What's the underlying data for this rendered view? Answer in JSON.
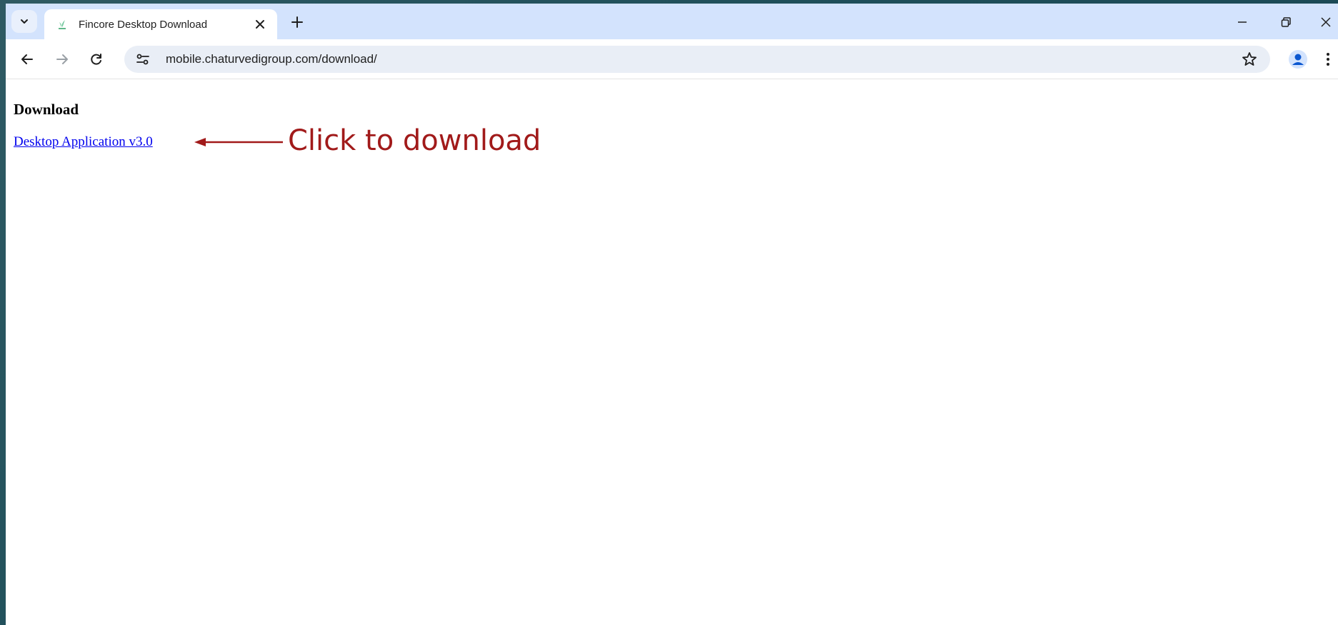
{
  "browser": {
    "tab": {
      "title": "Fincore Desktop Download"
    },
    "address_bar": {
      "url": "mobile.chaturvedigroup.com/download/"
    }
  },
  "page": {
    "heading": "Download",
    "link_text": "Desktop Application v3.0"
  },
  "annotation": {
    "text": "Click to download",
    "color": "#a11a1a"
  },
  "colors": {
    "tabstrip": "#d3e3fd",
    "link": "#0000ee",
    "omnibox": "#e9eef6"
  },
  "icons": [
    "chevron-down-icon",
    "favicon-icon",
    "close-icon",
    "plus-icon",
    "minimize-icon",
    "restore-icon",
    "window-close-icon",
    "back-arrow-icon",
    "forward-arrow-icon",
    "reload-icon",
    "site-settings-icon",
    "star-icon",
    "profile-icon",
    "kebab-menu-icon",
    "annotation-arrow"
  ]
}
